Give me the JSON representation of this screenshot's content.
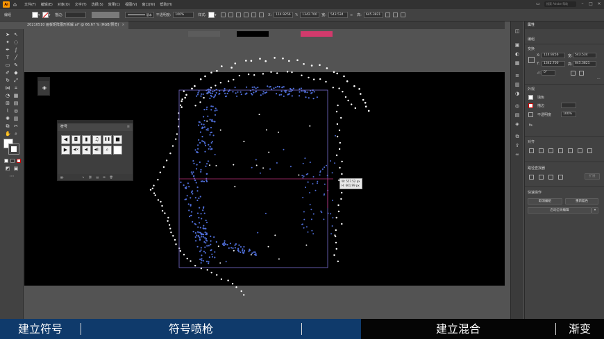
{
  "app": {
    "logo": "Ai",
    "menus": [
      "文件(F)",
      "编辑(E)",
      "对象(O)",
      "文字(T)",
      "选择(S)",
      "效果(C)",
      "视图(V)",
      "窗口(W)",
      "帮助(H)"
    ],
    "search_placeholder": "搜索 Adobe 帮助"
  },
  "control_bar": {
    "group_label": "编组",
    "stroke_label": "描边:",
    "stroke_style": "基本",
    "opacity_label": "不透明度:",
    "opacity_value": "100%",
    "style_label": "样式:",
    "x_label": "X:",
    "x_value": "114.9256",
    "y_label": "Y:",
    "y_value": "1342.700",
    "w_label": "宽:",
    "w_value": "543.534",
    "h_label": "高:",
    "h_value": "645.3821"
  },
  "document": {
    "tab_title": "20210510 画板矩阵图形拆解.ai* @ 66.67 % (RGB/预览)",
    "tab_close": "×"
  },
  "colors": {
    "swatch_gray1": "#5c5c5c",
    "swatch_black": "#000000",
    "swatch_pink": "#d23a6c",
    "dot_blue": "#4f6ed8",
    "dot_white": "#ffffff",
    "bbox_purple": "#7a6fd0",
    "guide_magenta": "#c0307a"
  },
  "canvas": {
    "dimension_tooltip_w": "W: 557.52 px",
    "dimension_tooltip_h": "H: 661.99 px"
  },
  "symbols_panel": {
    "title": "符号",
    "menu": "≡",
    "icons": [
      "arrow-left-icon",
      "camera-icon",
      "film-icon",
      "music-note-icon",
      "pause-icon",
      "stop-icon",
      "play-icon",
      "mute-icon",
      "volume-icon",
      "speaker-icon",
      "search-icon",
      "blank-symbol"
    ],
    "glyphs": [
      "◀",
      "◘",
      "▮",
      "♫",
      "❚❚",
      "■",
      "▶",
      "◀×",
      "◀)",
      "◀))",
      "⌕",
      ""
    ]
  },
  "properties_panel": {
    "tab_title": "属性",
    "group_header": "编组",
    "transform_header": "变换",
    "x_label": "X:",
    "x_value": "114.9256",
    "y_label": "Y:",
    "y_value": "1342.700",
    "w_label": "宽:",
    "w_value": "543.534",
    "h_label": "高:",
    "h_value": "645.3821",
    "angle_label": "⊿:",
    "angle_value": "0°",
    "appearance_header": "外观",
    "fill_label": "填色",
    "stroke_label": "描边",
    "opacity_label": "不透明度",
    "opacity_value": "100%",
    "fx_label": "fx.",
    "align_header": "对齐",
    "pathfinder_header": "路径查找器",
    "expand_label": "扩展",
    "quick_actions_header": "快速操作",
    "ungroup_button": "取消编组",
    "recolor_button": "重新着色",
    "global_edit_button": "启动全局编辑"
  },
  "subtitles": {
    "seg1": "建立符号",
    "seg2": "符号喷枪",
    "seg3": "建立混合",
    "seg4": "渐变"
  }
}
